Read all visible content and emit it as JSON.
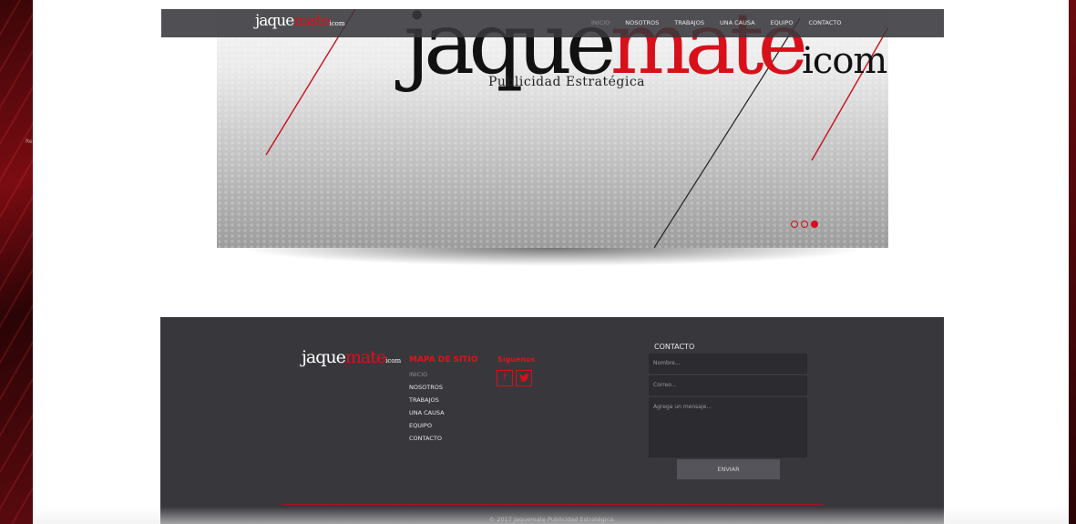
{
  "brand": {
    "logo_black": "jaque",
    "logo_red": "mate",
    "logo_suffix": "icom"
  },
  "nav": {
    "items": [
      {
        "label": "INICIO",
        "active": true
      },
      {
        "label": "NOSOTROS",
        "active": false
      },
      {
        "label": "TRABAJOS",
        "active": false
      },
      {
        "label": "UNA CAUSA",
        "active": false
      },
      {
        "label": "EQUIPO",
        "active": false
      },
      {
        "label": "CONTACTO",
        "active": false
      }
    ]
  },
  "hero": {
    "logo_black": "jaque",
    "logo_red": "mate",
    "logo_suffix": "icom",
    "tagline": "Publicidad Estratégica",
    "slides_total": 3,
    "active_slide": 3
  },
  "left_edge_text": "Re",
  "footer": {
    "sitemap_title": "MAPA DE SITIO",
    "sitemap_items": [
      "INICIO",
      "NOSOTROS",
      "TRABAJOS",
      "UNA CAUSA",
      "EQUIPO",
      "CONTACTO"
    ],
    "follow_title": "Síguenos",
    "social": [
      {
        "icon": "facebook-icon",
        "glyph": "f"
      },
      {
        "icon": "twitter-icon",
        "glyph": "t"
      }
    ],
    "contact_title": "CONTACTO",
    "name_placeholder": "Nombre...",
    "email_placeholder": "Correo...",
    "message_placeholder": "Agrega un mensaje...",
    "send_label": "ENVIAR",
    "copyright": "© 2017 Jaquemate Publicidad Estratégica."
  },
  "colors": {
    "brand_red": "#d8101a",
    "footer_bg": "#38373c",
    "nav_bg": "#38383c"
  }
}
